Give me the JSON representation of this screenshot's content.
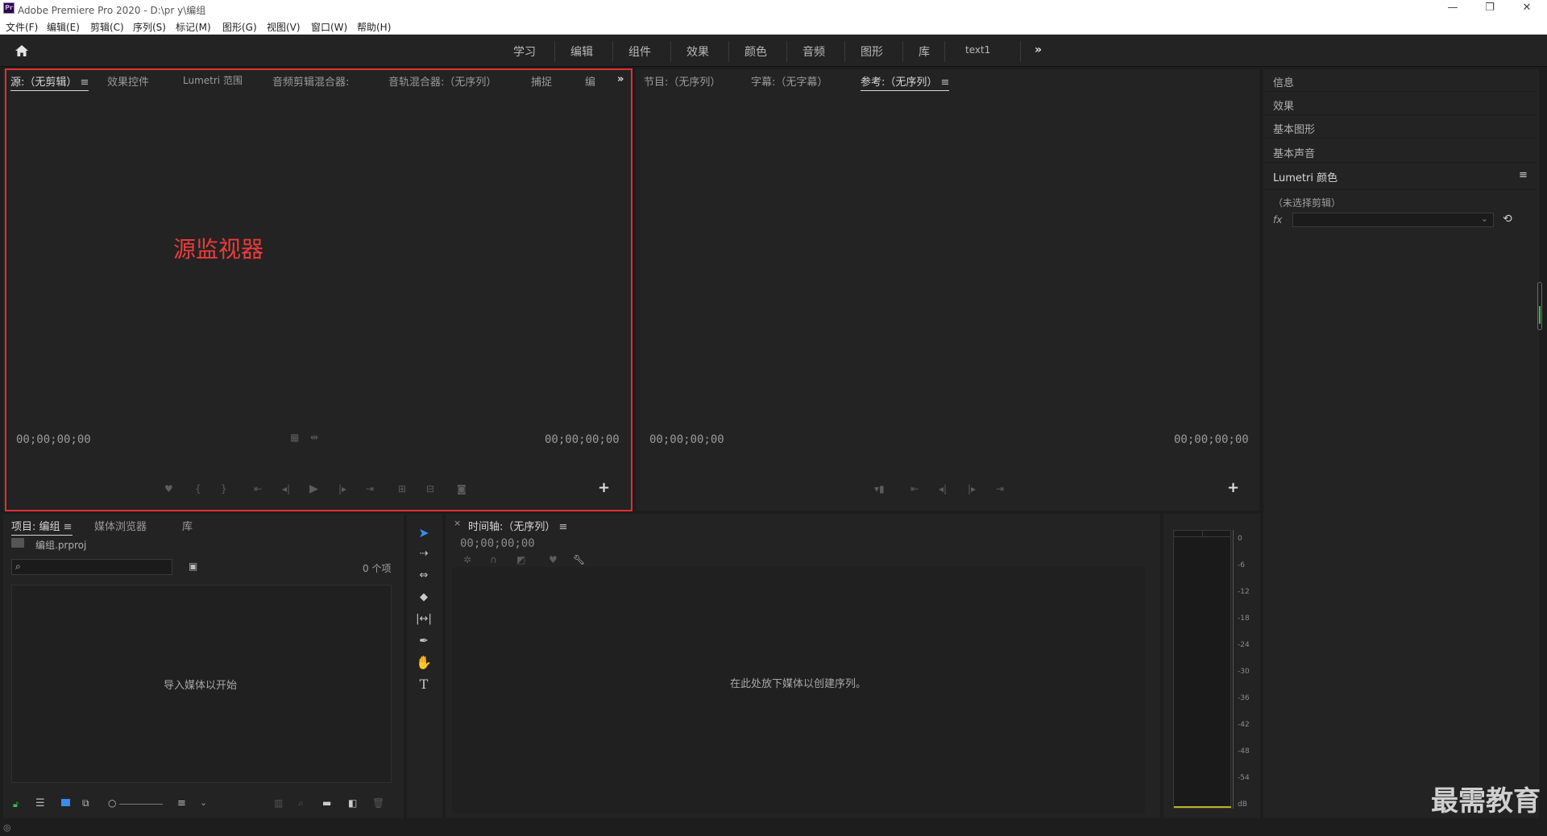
{
  "window": {
    "title": "Adobe Premiere Pro 2020 - D:\\pr y\\编组",
    "logo": "Pr",
    "controls": [
      "—",
      "❐",
      "✕"
    ]
  },
  "menubar": [
    "文件(F)",
    "编辑(E)",
    "剪辑(C)",
    "序列(S)",
    "标记(M)",
    "图形(G)",
    "视图(V)",
    "窗口(W)",
    "帮助(H)"
  ],
  "workspaces": [
    "学习",
    "编辑",
    "组件",
    "效果",
    "颜色",
    "音频",
    "图形",
    "库",
    "text1"
  ],
  "source_panel": {
    "tabs": [
      "源:（无剪辑）",
      "效果控件",
      "Lumetri 范围",
      "音频剪辑混合器:",
      "音轨混合器:（无序列）",
      "捕捉",
      "编"
    ],
    "timecode_left": "00;00;00;00",
    "timecode_right": "00;00;00;00",
    "annotation": "源监视器"
  },
  "program_panel": {
    "tabs": [
      "节目:（无序列）",
      "字幕:（无字幕）",
      "参考:（无序列）"
    ],
    "timecode_left": "00;00;00;00",
    "timecode_right": "00;00;00;00"
  },
  "right_panel": {
    "items": [
      "信息",
      "效果",
      "基本图形",
      "基本声音"
    ],
    "lumetri": {
      "title": "Lumetri 颜色",
      "no_clip": "（未选择剪辑）",
      "fx": "fx"
    }
  },
  "project_panel": {
    "tabs": [
      "项目: 编组",
      "媒体浏览器",
      "库"
    ],
    "file": "编组.prproj",
    "item_count": "0 个项",
    "empty_text": "导入媒体以开始"
  },
  "timeline_panel": {
    "tab": "时间轴:（无序列）",
    "close": "×",
    "timecode": "00;00;00;00",
    "empty_text": "在此处放下媒体以创建序列。"
  },
  "audio_meter": {
    "ticks": [
      "0",
      "-6",
      "-12",
      "-18",
      "-24",
      "-30",
      "-36",
      "-42",
      "-48",
      "-54",
      "dB"
    ]
  },
  "watermark": "最需教育"
}
